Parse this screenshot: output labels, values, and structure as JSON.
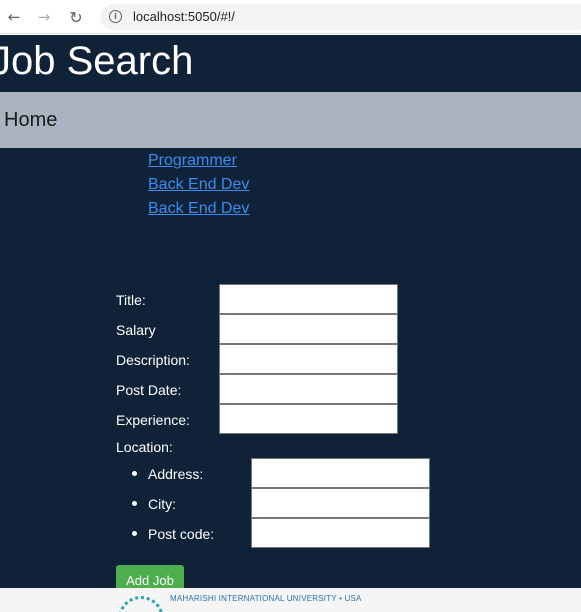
{
  "browser": {
    "url": "localhost:5050/#!/",
    "back_icon": "←",
    "forward_icon": "→",
    "reload_icon": "↻",
    "info_icon": "i"
  },
  "header": {
    "title": "Job Search"
  },
  "nav": {
    "home_label": "Home"
  },
  "jobs": [
    {
      "title": "Programmer"
    },
    {
      "title": "Back End Dev"
    },
    {
      "title": "Back End Dev"
    }
  ],
  "form": {
    "title_label": "Title:",
    "salary_label": "Salary",
    "description_label": "Description:",
    "post_date_label": "Post Date:",
    "experience_label": "Experience:",
    "location_label": "Location:",
    "address_label": "Address:",
    "city_label": "City:",
    "post_code_label": "Post code:",
    "title_value": "",
    "salary_value": "",
    "description_value": "",
    "post_date_value": "",
    "experience_value": "",
    "address_value": "",
    "city_value": "",
    "post_code_value": "",
    "submit_label": "Add Job"
  },
  "footer": {
    "text": "MAHARISHI INTERNATIONAL UNIVERSITY • USA"
  },
  "colors": {
    "page_bg": "#0f2237",
    "nav_bg": "#aab4c0",
    "link": "#3d8cf0",
    "button": "#4cae4c"
  }
}
